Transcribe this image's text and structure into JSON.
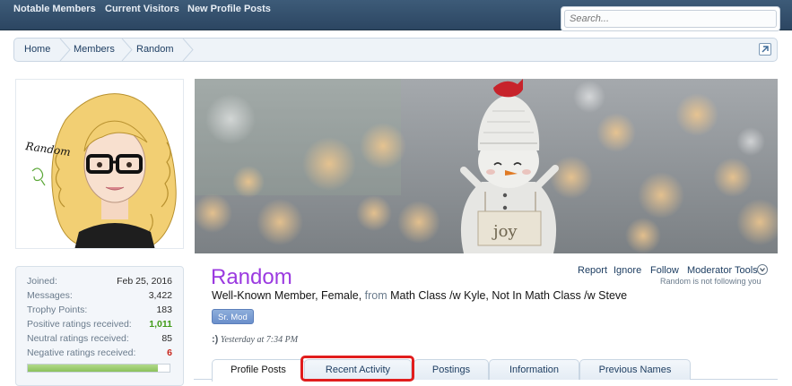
{
  "topnav": {
    "links": [
      "Notable Members",
      "Current Visitors",
      "New Profile Posts"
    ],
    "search_placeholder": "Search..."
  },
  "breadcrumb": [
    "Home",
    "Members",
    "Random"
  ],
  "profile": {
    "username": "Random",
    "title_prefix": "Well-Known Member, Female, ",
    "from_word": "from",
    "location": " Math Class /w Kyle, Not In Math Class /w Steve",
    "badge": "Sr. Mod",
    "status_icon": ":)",
    "status_time": "Yesterday at 7:34 PM",
    "actions": [
      "Report",
      "Ignore",
      "Follow",
      "Moderator Tools"
    ],
    "follow_note": "Random is not following you"
  },
  "stats": [
    {
      "label": "Joined:",
      "value": "Feb 25, 2016",
      "style": ""
    },
    {
      "label": "Messages:",
      "value": "3,422",
      "style": ""
    },
    {
      "label": "Trophy Points:",
      "value": "183",
      "style": ""
    },
    {
      "label": "Positive ratings received:",
      "value": "1,011",
      "style": "green"
    },
    {
      "label": "Neutral ratings received:",
      "value": "85",
      "style": ""
    },
    {
      "label": "Negative ratings received:",
      "value": "6",
      "style": "red"
    }
  ],
  "rating_bar_fraction": 0.92,
  "banner": {
    "sign_text": "joy"
  },
  "avatar": {
    "signature_text": "Random"
  },
  "tabs": [
    {
      "label": "Profile Posts",
      "active": true
    },
    {
      "label": "Recent Activity",
      "active": false
    },
    {
      "label": "Postings",
      "active": false
    },
    {
      "label": "Information",
      "active": false
    },
    {
      "label": "Previous Names",
      "active": false
    }
  ],
  "colors": {
    "nav_bg": "#34516e",
    "username": "#9b3ae0",
    "link": "#1e3e62",
    "highlight": "#e11d1d"
  }
}
